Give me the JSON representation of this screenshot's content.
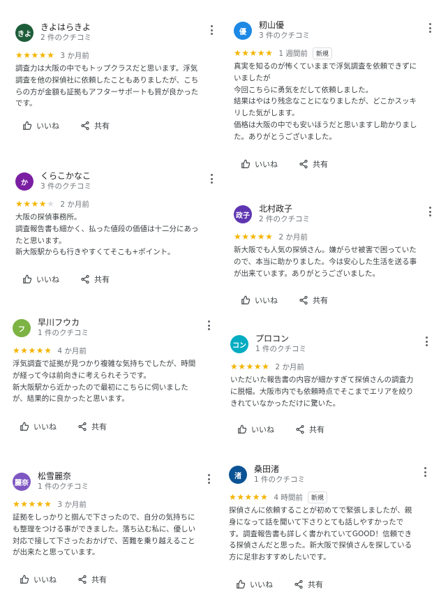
{
  "colors": {
    "star": "#f4b400",
    "star_empty": "#dadce0",
    "badge_border": "#dadce0"
  },
  "actions": {
    "like_label": "いいね",
    "share_label": "共有"
  },
  "reviews": [
    {
      "name": "きよはらきよ",
      "count": "2 件のクチコミ",
      "avatar_text": "きよ",
      "avatar_color": "#1e5d3a",
      "rating": 5,
      "ago": "3 か月前",
      "badge": "",
      "text": "調査力は大阪の中でもトップクラスだと思います。浮気\n調査を他の探偵社に依頼したこともありましたが、こち\nらの方が金額も証拠もアフターサポートも質が良かった\nです。"
    },
    {
      "name": "くらこかなこ",
      "count": "3 件のクチコミ",
      "avatar_text": "か",
      "avatar_color": "#7b1fa2",
      "rating": 4,
      "ago": "2 か月前",
      "badge": "",
      "text": "大阪の探偵事務所。\n調査報告書も細かく、払った値段の価値は十二分にあっ\nたと思います。\n新大阪駅からも行きやすくてそこも+ポイント。"
    },
    {
      "name": "早川フウカ",
      "count": "1 件のクチコミ",
      "avatar_text": "フ",
      "avatar_color": "#7cb342",
      "rating": 5,
      "ago": "4 か月前",
      "badge": "",
      "text": "浮気調査で証拠が見つかり複雑な気持ちでしたが、時間\nが経って今は前向きに考えられそうです。\n新大阪駅から近かったので最初にこちらに伺いました\nが、結果的に良かったと思います。"
    },
    {
      "name": "松雪麗奈",
      "count": "1 件のクチコミ",
      "avatar_text": "麗奈",
      "avatar_color": "#7e57c2",
      "rating": 5,
      "ago": "3 か月前",
      "badge": "",
      "text": "証拠をしっかりと掴んで下さったので、自分の気持ちに\nも整理をつける事ができました。落ち込む私に、優しい\n対応で接して下さったおかげで、苦難を乗り越えること\nが出来たと思っています。"
    },
    {
      "name": "籾山優",
      "count": "3 件のクチコミ",
      "avatar_text": "優",
      "avatar_color": "#1e88e5",
      "rating": 5,
      "ago": "1 週間前",
      "badge": "新規",
      "text": "真実を知るのが怖くていままで浮気調査を依頼できずに\nいましたが\n今回こちらに勇気をだして依頼しました。\n結果はやはり残念なことになりましたが、どこかスッキ\nリした気がします。\n価格は大阪の中でも安いほうだと思いますし助かりまし\nた。ありがとうございました。"
    },
    {
      "name": "北村政子",
      "count": "2 件のクチコミ",
      "avatar_text": "政子",
      "avatar_color": "#5e35b1",
      "rating": 5,
      "ago": "2 か月前",
      "badge": "",
      "text": "新大阪でも人気の探偵さん。嫌がらせ被害で困っていた\nので、本当に助かりました。今は安心した生活を送る事\nが出来ています。ありがとうございました。"
    },
    {
      "name": "プロコン",
      "count": "1 件のクチコミ",
      "avatar_text": "コン",
      "avatar_color": "#00acc1",
      "rating": 5,
      "ago": "2 か月前",
      "badge": "",
      "text": "いただいた報告書の内容が細かすぎて探偵さんの調査力\nに脱帽。大阪市内でも依頼時点でそこまでエリアを絞り\nきれていなかっただけに驚いた。"
    },
    {
      "name": "桑田渚",
      "count": "1 件のクチコミ",
      "avatar_text": "渚",
      "avatar_color": "#0b5394",
      "rating": 5,
      "ago": "4 時間前",
      "badge": "新規",
      "text": "探偵さんに依頼することが初めてで緊張しましたが、親\n身になって話を聞いて下さりとても話しやすかったで\nす。調査報告書も詳しく書かれていてGOOD！信頼でき\nる探偵さんだと思った。新大阪で探偵さんを探している\n方に足非おすすめしたいです。"
    }
  ]
}
